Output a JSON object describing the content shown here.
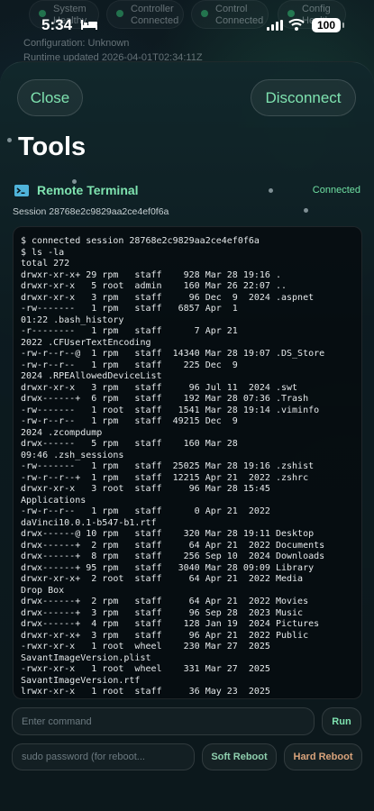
{
  "status_bar": {
    "time": "5:34",
    "battery": "100"
  },
  "background_app": {
    "pills": [
      {
        "line1": "System",
        "line2": "Healthy"
      },
      {
        "line1": "Controller",
        "line2": "Connected"
      },
      {
        "line1": "Control",
        "line2": "Connected"
      },
      {
        "line1": "Config",
        "line2": "Healthy"
      }
    ],
    "configuration": "Configuration: Unknown",
    "runtime": "Runtime updated 2026-04-01T02:34:11Z"
  },
  "header": {
    "close_label": "Close",
    "disconnect_label": "Disconnect",
    "title": "Tools"
  },
  "terminal": {
    "title": "Remote Terminal",
    "status": "Connected",
    "session": "Session 28768e2c9829aa2ce4ef0f6a",
    "output": "$ connected session 28768e2c9829aa2ce4ef0f6a\n$ ls -la\ntotal 272\ndrwxr-xr-x+ 29 rpm   staff    928 Mar 28 19:16 .\ndrwxr-xr-x   5 root  admin    160 Mar 26 22:07 ..\ndrwxr-xr-x   3 rpm   staff     96 Dec  9  2024 .aspnet\n-rw-------   1 rpm   staff   6857 Apr  1\n01:22 .bash_history\n-r--------   1 rpm   staff      7 Apr 21\n2022 .CFUserTextEncoding\n-rw-r--r--@  1 rpm   staff  14340 Mar 28 19:07 .DS_Store\n-rw-r--r--   1 rpm   staff    225 Dec  9\n2024 .RPEAllowedDeviceList\ndrwxr-xr-x   3 rpm   staff     96 Jul 11  2024 .swt\ndrwx------+  6 rpm   staff    192 Mar 28 07:36 .Trash\n-rw-------   1 root  staff   1541 Mar 28 19:14 .viminfo\n-rw-r--r--   1 rpm   staff  49215 Dec  9\n2024 .zcompdump\ndrwx------   5 rpm   staff    160 Mar 28\n09:46 .zsh_sessions\n-rw-------   1 rpm   staff  25025 Mar 28 19:16 .zshist\n-rw-r--r--+  1 rpm   staff  12215 Apr 21  2022 .zshrc\ndrwxr-xr-x   3 root  staff     96 Mar 28 15:45\nApplications\n-rw-r--r--   1 rpm   staff      0 Apr 21  2022\ndaVinci10.0.1-b547-b1.rtf\ndrwx------@ 10 rpm   staff    320 Mar 28 19:11 Desktop\ndrwx------+  2 rpm   staff     64 Apr 21  2022 Documents\ndrwx------+  8 rpm   staff    256 Sep 10  2024 Downloads\ndrwx------+ 95 rpm   staff   3040 Mar 28 09:09 Library\ndrwxr-xr-x+  2 root  staff     64 Apr 21  2022 Media\nDrop Box\ndrwx------+  2 rpm   staff     64 Apr 21  2022 Movies\ndrwx------+  3 rpm   staff     96 Sep 28  2023 Music\ndrwx------+  4 rpm   staff    128 Jan 19  2024 Pictures\ndrwxr-xr-x+  3 rpm   staff     96 Apr 21  2022 Public\n-rwxr-xr-x   1 root  wheel    230 Mar 27  2025\nSavantImageVersion.plist\n-rwxr-xr-x   1 root  wheel    331 Mar 27  2025\nSavantImageVersion.rtf\nlrwxr-xr-x   1 root  staff     36 May 23  2025"
  },
  "controls": {
    "command_placeholder": "Enter command",
    "run_label": "Run",
    "sudo_placeholder": "sudo password (for reboot...",
    "soft_reboot_label": "Soft Reboot",
    "hard_reboot_label": "Hard Reboot"
  },
  "colors": {
    "accent_green": "#7fe3b0",
    "hard_reboot": "#d9a37b",
    "terminal_icon": "#4fb3d9"
  }
}
